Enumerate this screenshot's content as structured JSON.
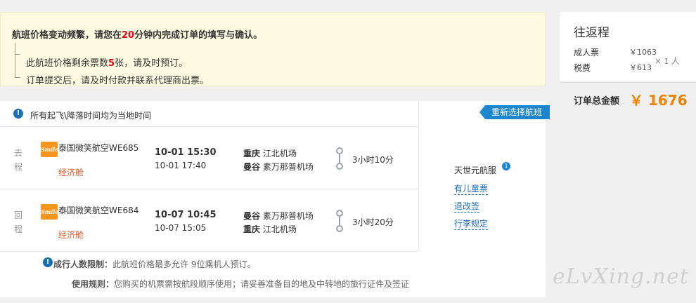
{
  "notice": {
    "title_prefix": "航班价格变动频繁，请您在",
    "title_minutes": "20",
    "title_suffix": "分钟内完成订单的填写与确认。",
    "line1_prefix": "此航班价格剩余票数",
    "line1_count": "5",
    "line1_suffix": "张，请及时预订。",
    "line2": "订单提交后，请及时付款并联系代理商出票。"
  },
  "summary": {
    "title": "往返程",
    "adult_label": "成人票",
    "adult_price": "￥1063",
    "tax_label": "税费",
    "tax_price": "￥613",
    "multiplier_sign": "×",
    "multiplier_count": "1",
    "multiplier_unit": "人",
    "total_label": "订单总金额",
    "total_amount": "￥ 1676"
  },
  "panel": {
    "local_time_note": "所有起飞\\降落时间均为当地时间",
    "reselect_label": "重新选择航班"
  },
  "segments": [
    {
      "tag": "去程",
      "logo_text": "Smile",
      "airline": "泰国微笑航空WE685",
      "cabin": "经济舱",
      "dep_time": "10-01 15:30",
      "arr_time": "10-01 17:40",
      "dep_city": "重庆",
      "dep_airport": "江北机场",
      "arr_city": "曼谷",
      "arr_airport": "素万那普机场",
      "duration": "3小时10分"
    },
    {
      "tag": "回程",
      "logo_text": "Smile",
      "airline": "泰国微笑航空WE684",
      "cabin": "经济舱",
      "dep_time": "10-07 10:45",
      "arr_time": "10-07 15:05",
      "dep_city": "曼谷",
      "dep_airport": "素万那普机场",
      "arr_city": "重庆",
      "arr_airport": "江北机场",
      "duration": "3小时20分"
    }
  ],
  "side": {
    "brand": "天世元航服",
    "links": [
      "有儿童票",
      "退改签",
      "行李规定"
    ]
  },
  "limits": {
    "count_label": "成行人数限制：",
    "count_text": "此航班价格最多允许 9位乘机人预订。",
    "rule_label": "使用规则：",
    "rule_text": "您购买的机票需按航段顺序使用；请妥善准备目的地及中转地的旅行证件及签证"
  },
  "watermark": "eLvXing.net",
  "colors": {
    "accent_orange": "#f08200",
    "link_blue": "#1b6bbf",
    "button_blue": "#1e86cf",
    "highlight_red": "#e60012"
  }
}
